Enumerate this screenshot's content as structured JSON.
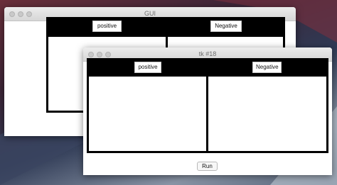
{
  "back_window": {
    "title": "GUI",
    "positive_label": "positive",
    "negative_label": "Negative"
  },
  "front_window": {
    "title": "tk #18",
    "positive_label": "positive",
    "negative_label": "Negative",
    "run_label": "Run"
  }
}
